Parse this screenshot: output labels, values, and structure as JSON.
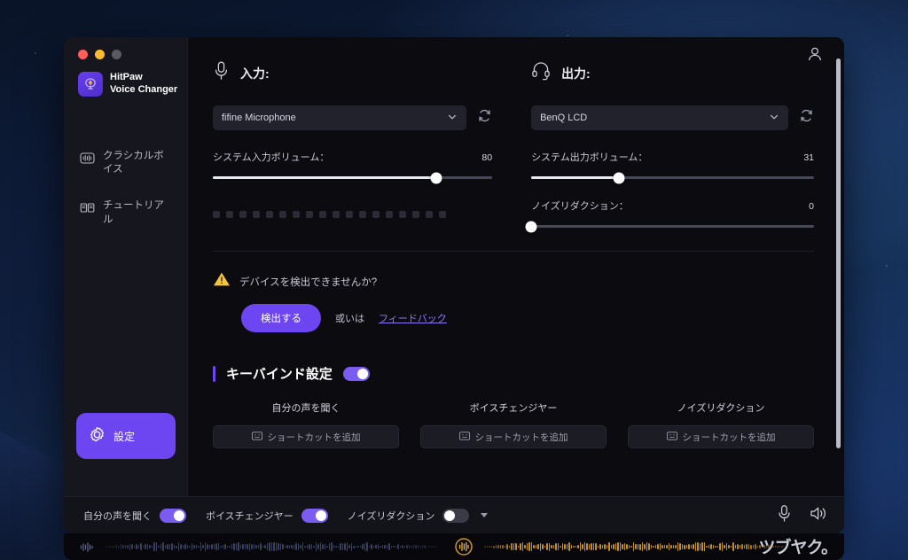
{
  "app": {
    "brand_line1": "HitPaw",
    "brand_line2": "Voice Changer"
  },
  "sidebar": {
    "items": [
      {
        "label": "クラシカルボイス",
        "icon": "waveform-icon"
      },
      {
        "label": "チュートリアル",
        "icon": "book-icon"
      }
    ],
    "settings_label": "設定",
    "settings_icon": "gear-icon"
  },
  "input": {
    "heading": "入力:",
    "icon": "microphone-icon",
    "device": "fifine  Microphone",
    "refresh_icon": "refresh-icon",
    "volume_label": "システム入力ボリューム：",
    "volume_value": "80",
    "volume_percent": 80,
    "meter_segments": 18
  },
  "output": {
    "heading": "出力:",
    "icon": "headset-icon",
    "device": "BenQ LCD",
    "refresh_icon": "refresh-icon",
    "volume_label": "システム出力ボリューム：",
    "volume_value": "31",
    "volume_percent": 31,
    "noise_label": "ノイズリダクション：",
    "noise_value": "0",
    "noise_percent": 0
  },
  "detect": {
    "warning_icon": "warning-triangle-icon",
    "warning_text": "デバイスを検出できませんか?",
    "button_label": "検出する",
    "or_text": "或いは",
    "feedback_label": "フィードバック"
  },
  "keybind": {
    "title": "キーバインド設定",
    "enabled": true,
    "columns": [
      {
        "title": "自分の声を聞く",
        "button_label": "ショートカットを追加"
      },
      {
        "title": "ボイスチェンジヤー",
        "button_label": "ショートカットを追加"
      },
      {
        "title": "ノイズリダクション",
        "button_label": "ショートカットを追加"
      }
    ]
  },
  "bottombar": {
    "toggles": [
      {
        "label": "自分の声を聞く",
        "on": true
      },
      {
        "label": "ボイスチェンジヤー",
        "on": true
      },
      {
        "label": "ノイズリダクション",
        "on": false,
        "has_caret": true
      }
    ],
    "mic_icon": "microphone-icon",
    "speaker_icon": "speaker-icon"
  },
  "waveform": {
    "left_icon": "waveform-small-icon",
    "right_icon": "waveform-circle-icon",
    "left_color": "#3b4560",
    "right_color": "#c9982e",
    "watermark": "ツブヤク。"
  },
  "titlebar": {
    "account_icon": "account-icon"
  },
  "colors": {
    "accent": "#6d46f2",
    "toggle_on": "#7b5cf0",
    "window_bg": "#0b0b10",
    "sidebar_bg": "#16161e",
    "warning": "#f2c53d",
    "link": "#8d7cf5"
  }
}
